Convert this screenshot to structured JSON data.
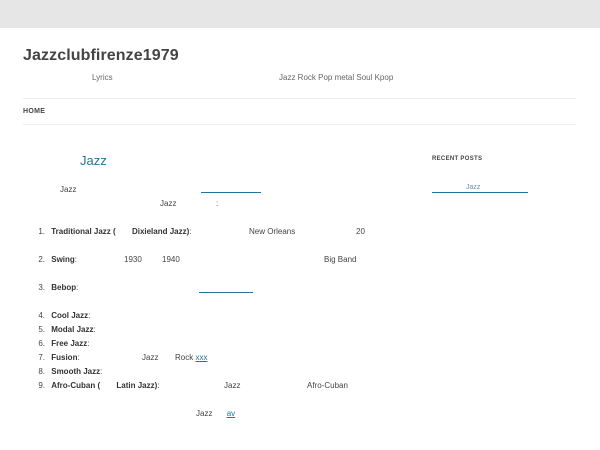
{
  "site": {
    "title": "Jazzclubfirenze1979",
    "tagline_left": "Lyrics",
    "tagline_right": "Jazz Rock Pop metal Soul Kpop"
  },
  "nav": {
    "home": "HOME"
  },
  "article": {
    "title": "Jazz",
    "intro_word": "Jazz",
    "second_line_word": "Jazz",
    "second_line_colon": ":",
    "list": [
      {
        "num": "1.",
        "bold_a": "Traditional Jazz (",
        "bold_b": "Dixieland Jazz)",
        "text_a": ":",
        "text_b": "New Orleans",
        "text_c": "20"
      },
      {
        "num": "2.",
        "bold_a": "Swing",
        "text_a": ":",
        "text_b": "1930",
        "text_c": "1940",
        "text_d": "Big Band"
      },
      {
        "num": "3.",
        "bold_a": "Bebop",
        "text_a": ":"
      },
      {
        "num": "4.",
        "bold_a": "Cool Jazz",
        "text_a": ":"
      },
      {
        "num": "5.",
        "bold_a": "Modal Jazz",
        "text_a": ":"
      },
      {
        "num": "6.",
        "bold_a": "Free Jazz",
        "text_a": ":"
      },
      {
        "num": "7.",
        "bold_a": "Fusion",
        "text_a": ":",
        "text_b": "Jazz",
        "text_c": "Rock",
        "link": "xxx"
      },
      {
        "num": "8.",
        "bold_a": "Smooth Jazz",
        "text_a": ":"
      },
      {
        "num": "9.",
        "bold_a": "Afro-Cuban (",
        "bold_b": "Latin Jazz)",
        "text_a": ":",
        "text_b": "Jazz",
        "text_c": "Afro-Cuban"
      }
    ],
    "footer_word": "Jazz",
    "footer_link": "av"
  },
  "sidebar": {
    "title": "RECENT POSTS",
    "link": "Jazz"
  }
}
